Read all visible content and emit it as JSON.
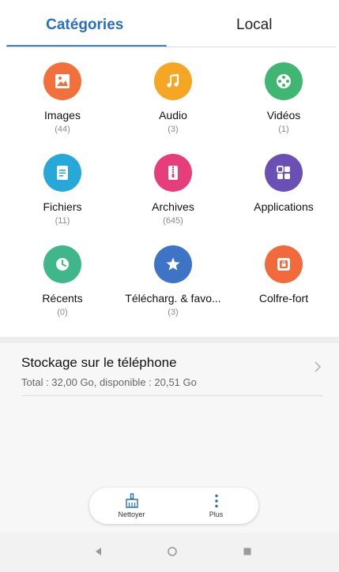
{
  "tabs": [
    {
      "label": "Catégories",
      "active": true
    },
    {
      "label": "Local",
      "active": false
    }
  ],
  "categories": [
    {
      "name": "Images",
      "count": "(44)",
      "icon": "image-icon",
      "color": "#f2703b"
    },
    {
      "name": "Audio",
      "count": "(3)",
      "icon": "music-note-icon",
      "color": "#f5a623"
    },
    {
      "name": "Vidéos",
      "count": "(1)",
      "icon": "video-reel-icon",
      "color": "#3fb772"
    },
    {
      "name": "Fichiers",
      "count": "(11)",
      "icon": "document-icon",
      "color": "#26a8d8"
    },
    {
      "name": "Archives",
      "count": "(645)",
      "icon": "archive-zip-icon",
      "color": "#e63e7b"
    },
    {
      "name": "Applications",
      "count": "",
      "icon": "apps-grid-icon",
      "color": "#6a4fb5"
    },
    {
      "name": "Récents",
      "count": "(0)",
      "icon": "clock-icon",
      "color": "#3fb78a"
    },
    {
      "name": "Télécharg. & favo...",
      "count": "(3)",
      "icon": "star-icon",
      "color": "#3d74c6"
    },
    {
      "name": "Colfre-fort",
      "count": "",
      "icon": "safe-lock-icon",
      "color": "#f2693b"
    }
  ],
  "storage": {
    "title": "Stockage sur le téléphone",
    "details": "Total : 32,00  Go, disponible : 20,51  Go"
  },
  "bottom_actions": {
    "clean_label": "Nettoyer",
    "more_label": "Plus"
  }
}
